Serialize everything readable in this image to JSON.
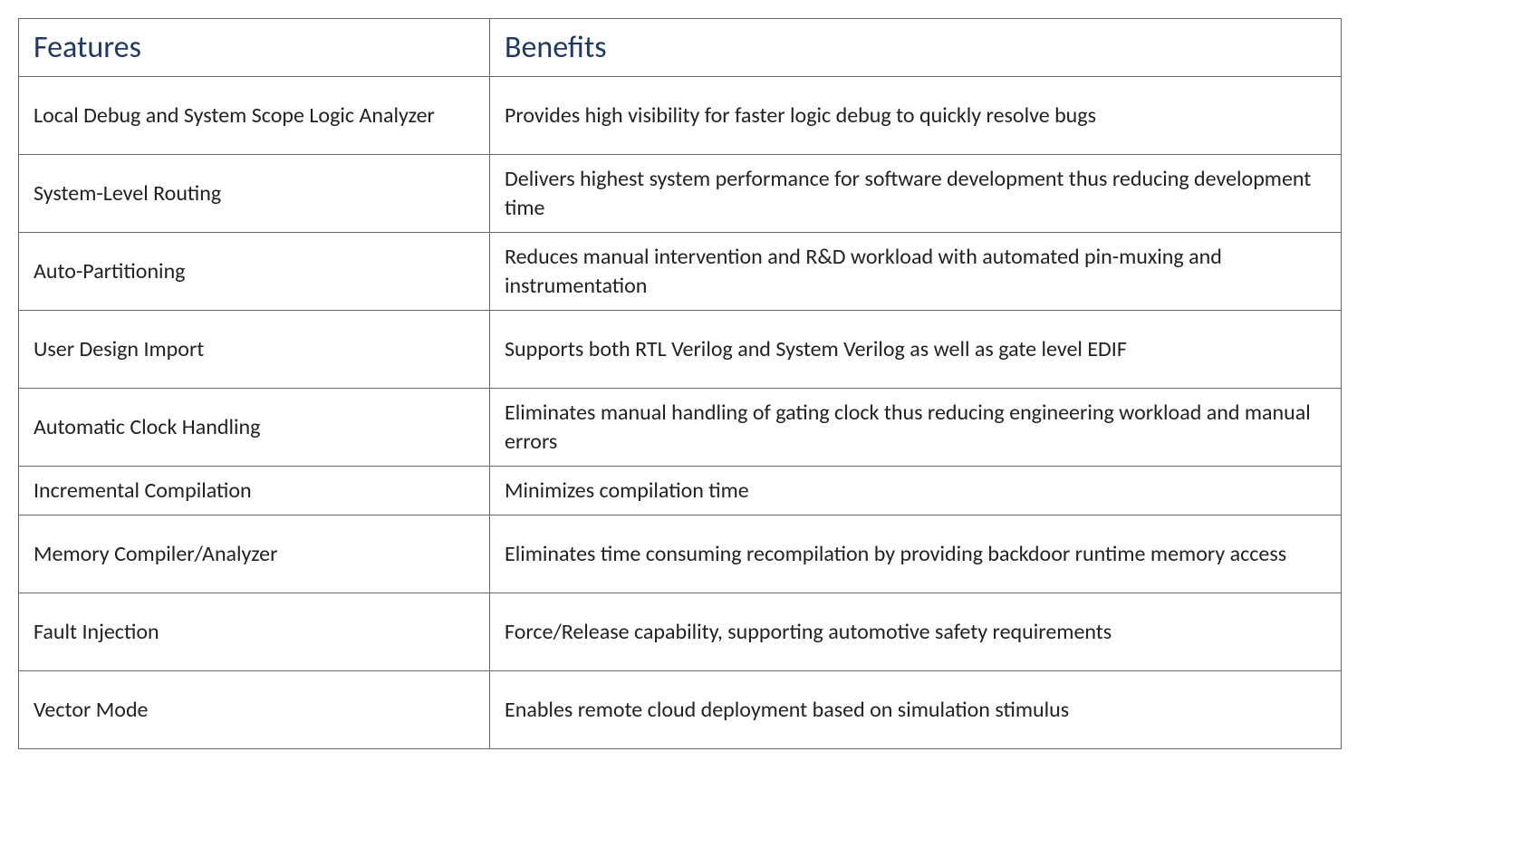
{
  "headers": {
    "features": "Features",
    "benefits": "Benefits"
  },
  "rows": [
    {
      "feature": "Local Debug and System Scope Logic Analyzer",
      "benefit": "Provides high visibility for faster logic debug to quickly resolve bugs",
      "single": false
    },
    {
      "feature": "System-Level Routing",
      "benefit": "Delivers highest system performance for software development thus reducing development time",
      "single": false
    },
    {
      "feature": "Auto-Partitioning",
      "benefit": "Reduces manual intervention and R&D workload with automated pin-muxing and instrumentation",
      "single": false
    },
    {
      "feature": "User Design Import",
      "benefit": "Supports both RTL Verilog and System Verilog as well as gate level EDIF",
      "single": false
    },
    {
      "feature": "Automatic Clock Handling",
      "benefit": "Eliminates manual handling of gating clock thus reducing engineering workload and manual errors",
      "single": false
    },
    {
      "feature": "Incremental Compilation",
      "benefit": "Minimizes compilation time",
      "single": true
    },
    {
      "feature": "Memory Compiler/Analyzer",
      "benefit": "Eliminates time consuming recompilation by providing backdoor runtime memory access",
      "single": false
    },
    {
      "feature": "Fault Injection",
      "benefit": "Force/Release capability, supporting automotive safety requirements",
      "single": false
    },
    {
      "feature": "Vector Mode",
      "benefit": "Enables remote cloud deployment based on simulation stimulus",
      "single": false
    }
  ]
}
